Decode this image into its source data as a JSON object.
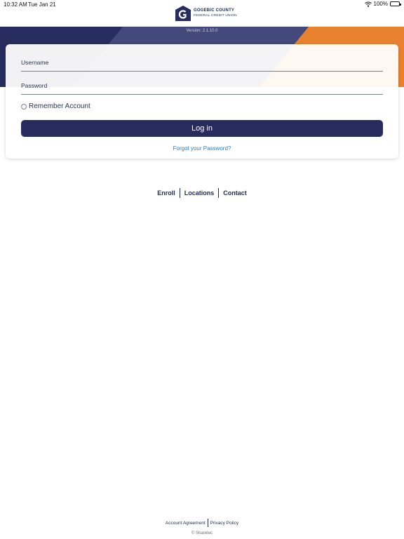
{
  "status_bar": {
    "time": "10:32 AM",
    "date": "Tue Jan 21",
    "battery": "100%",
    "icons": [
      "wifi-icon",
      "battery-icon"
    ]
  },
  "brand": {
    "line1": "GOGEBIC COUNTY",
    "line2": "FEDERAL CREDIT UNION",
    "colors": {
      "navy": "#262d5e",
      "orange": "#e8822f",
      "link_blue": "#2e79b5"
    }
  },
  "version": "Version: 2.1.10.0",
  "login": {
    "username_label": "Username",
    "password_label": "Password",
    "remember_label": "Remember Account",
    "login_button": "Log in",
    "forgot_link": "Forgot your Password?"
  },
  "nav_links": {
    "enroll": "Enroll",
    "locations": "Locations",
    "contact": "Contact"
  },
  "footer": {
    "account_agreement": "Account Agreement",
    "privacy_policy": "Privacy Policy",
    "copyright": "© Sharetec"
  }
}
